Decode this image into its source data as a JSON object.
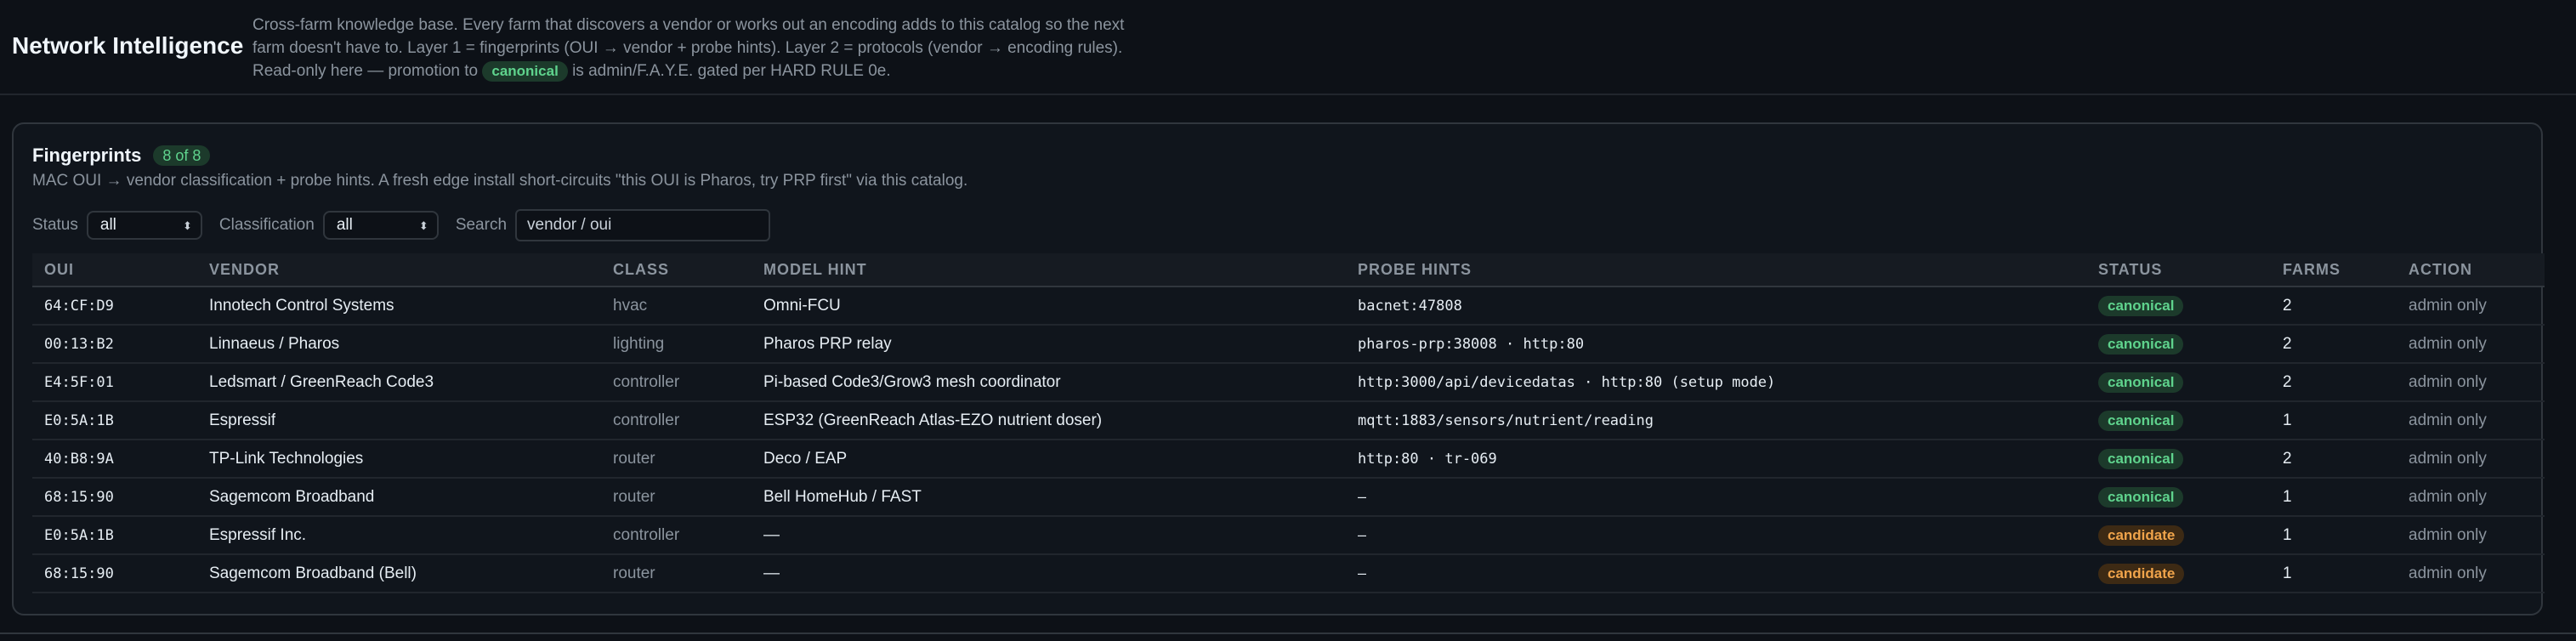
{
  "header": {
    "title": "Network Intelligence",
    "desc_line1": "Cross-farm knowledge base. Every farm that discovers a vendor or works out an encoding adds to this catalog so the next",
    "desc_line2": "farm doesn't have to. Layer 1 = fingerprints (OUI → vendor + probe hints). Layer 2 = protocols (vendor → encoding rules).",
    "desc_line3_pre": "Read-only here — promotion to",
    "desc_line3_pill": "canonical",
    "desc_line3_post": "is admin/F.A.Y.E. gated per HARD RULE 0e."
  },
  "panel": {
    "title": "Fingerprints",
    "count_badge": "8 of 8",
    "description": "MAC OUI → vendor classification + probe hints. A fresh edge install short-circuits \"this OUI is Pharos, try PRP first\" via this catalog."
  },
  "filters": {
    "status_label": "Status",
    "status_value": "all",
    "classification_label": "Classification",
    "classification_value": "all",
    "search_label": "Search",
    "search_placeholder": "vendor / oui",
    "search_value": ""
  },
  "table": {
    "columns": [
      "OUI",
      "VENDOR",
      "CLASS",
      "MODEL HINT",
      "PROBE HINTS",
      "STATUS",
      "FARMS",
      "ACTION"
    ],
    "rows": [
      {
        "oui": "64:CF:D9",
        "vendor": "Innotech Control Systems",
        "class": "hvac",
        "model": "Omni-FCU",
        "probe": "bacnet:47808",
        "status": "canonical",
        "farms": "2",
        "action": "admin only"
      },
      {
        "oui": "00:13:B2",
        "vendor": "Linnaeus / Pharos",
        "class": "lighting",
        "model": "Pharos PRP relay",
        "probe": "pharos-prp:38008 · http:80",
        "status": "canonical",
        "farms": "2",
        "action": "admin only"
      },
      {
        "oui": "E4:5F:01",
        "vendor": "Ledsmart / GreenReach Code3",
        "class": "controller",
        "model": "Pi-based Code3/Grow3 mesh coordinator",
        "probe": "http:3000/api/devicedatas · http:80 (setup mode)",
        "status": "canonical",
        "farms": "2",
        "action": "admin only"
      },
      {
        "oui": "E0:5A:1B",
        "vendor": "Espressif",
        "class": "controller",
        "model": "ESP32 (GreenReach Atlas-EZO nutrient doser)",
        "probe": "mqtt:1883/sensors/nutrient/reading",
        "status": "canonical",
        "farms": "1",
        "action": "admin only"
      },
      {
        "oui": "40:B8:9A",
        "vendor": "TP-Link Technologies",
        "class": "router",
        "model": "Deco / EAP",
        "probe": "http:80 · tr-069",
        "status": "canonical",
        "farms": "2",
        "action": "admin only"
      },
      {
        "oui": "68:15:90",
        "vendor": "Sagemcom Broadband",
        "class": "router",
        "model": "Bell HomeHub / FAST",
        "probe": "—",
        "status": "canonical",
        "farms": "1",
        "action": "admin only"
      },
      {
        "oui": "E0:5A:1B",
        "vendor": "Espressif Inc.",
        "class": "controller",
        "model": "—",
        "probe": "—",
        "status": "candidate",
        "farms": "1",
        "action": "admin only"
      },
      {
        "oui": "68:15:90",
        "vendor": "Sagemcom Broadband (Bell)",
        "class": "router",
        "model": "—",
        "probe": "—",
        "status": "candidate",
        "farms": "1",
        "action": "admin only"
      }
    ]
  },
  "colors": {
    "canonical": "#5fd38d",
    "candidate": "#f0a44b",
    "background": "#0d1117"
  }
}
